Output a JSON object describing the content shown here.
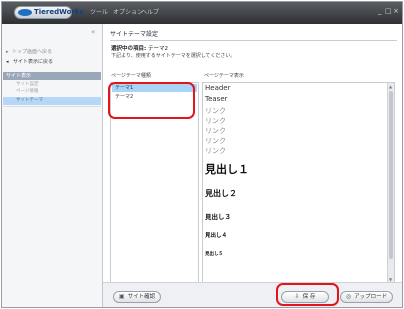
{
  "titlebar": {
    "logo": "TieredWorks",
    "menu": [
      "ツール",
      "オプション",
      "ヘルプ"
    ],
    "window_controls": [
      "_",
      "□",
      "×"
    ]
  },
  "sidebar": {
    "collapse_icon": "«",
    "links": [
      {
        "label": "トップ画面へ戻る"
      },
      {
        "label": "サイト表示に戻る"
      }
    ],
    "section": "サイト表示",
    "sub_items": [
      "サイト設定",
      "ページ情報"
    ],
    "selected_label": "サイトテーマ"
  },
  "main": {
    "section_title": "サイトテーマ設定",
    "current_label": "選択中の項目:",
    "current_value": "テーマ2",
    "instruction": "下記より、使用するサイトテーマを選択してください。",
    "list_label": "ページテーマ種類",
    "preview_label": "ページテーマ表示",
    "themes": [
      "テーマ1",
      "テーマ2"
    ],
    "selected_theme": "テーマ1",
    "preview": {
      "header": "Header",
      "teaser": "Teaser",
      "links": [
        "リンク",
        "リンク",
        "リンク",
        "リンク",
        "リンク"
      ],
      "headings": [
        "見出し１",
        "見出し２",
        "見出し３",
        "見出し４",
        "見出し５"
      ]
    }
  },
  "bottom": {
    "site_check": "サイト確認",
    "save": "保 存",
    "upload": "アップロード"
  },
  "colors": {
    "highlight": "#e2141c",
    "selection": "#a8d4f5",
    "titlebar": "#3a3c40"
  }
}
